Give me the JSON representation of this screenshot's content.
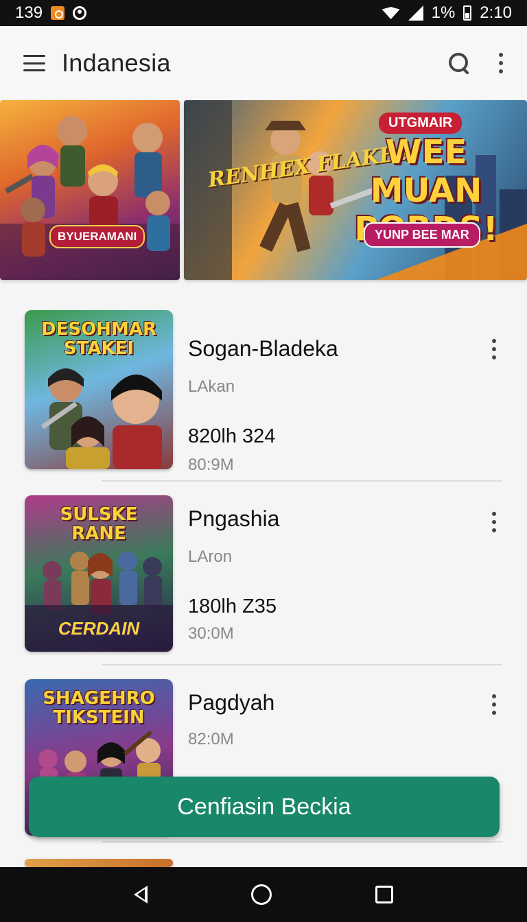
{
  "status_bar": {
    "time_left": "139",
    "battery_percent": "1%",
    "clock": "2:10"
  },
  "app_bar": {
    "title": "Indanesia"
  },
  "banners": [
    {
      "label": "BYUERAMANI"
    },
    {
      "top_tag": "UTGMAIR",
      "headline": "WEE MUAN PORDS!",
      "badge": "YUNP BEE MAR",
      "logo": "RENHEX FLAKES"
    }
  ],
  "list": [
    {
      "thumb_title": "DESOHMAR STAKEI",
      "thumb_sub": "",
      "title": "Sogan-Bladeka",
      "subtitle": "LAkan",
      "stat": "820lh 324",
      "size": "80:9M"
    },
    {
      "thumb_title": "SULSKE RANE",
      "thumb_sub": "CERDAIN",
      "title": "Pngashia",
      "subtitle": "LAron",
      "stat": "180lh Z35",
      "size": "30:0M"
    },
    {
      "thumb_title": "SHAGEHRO TIKSTEIN",
      "thumb_sub": "",
      "title": "Pagdyah",
      "subtitle": "",
      "stat": "",
      "size": "82:0M"
    }
  ],
  "cta": {
    "label": "Cenfiasin Beckia"
  },
  "colors": {
    "accent": "#18876a",
    "status_bar": "#111111",
    "nav_bar": "#0e0e0e"
  }
}
